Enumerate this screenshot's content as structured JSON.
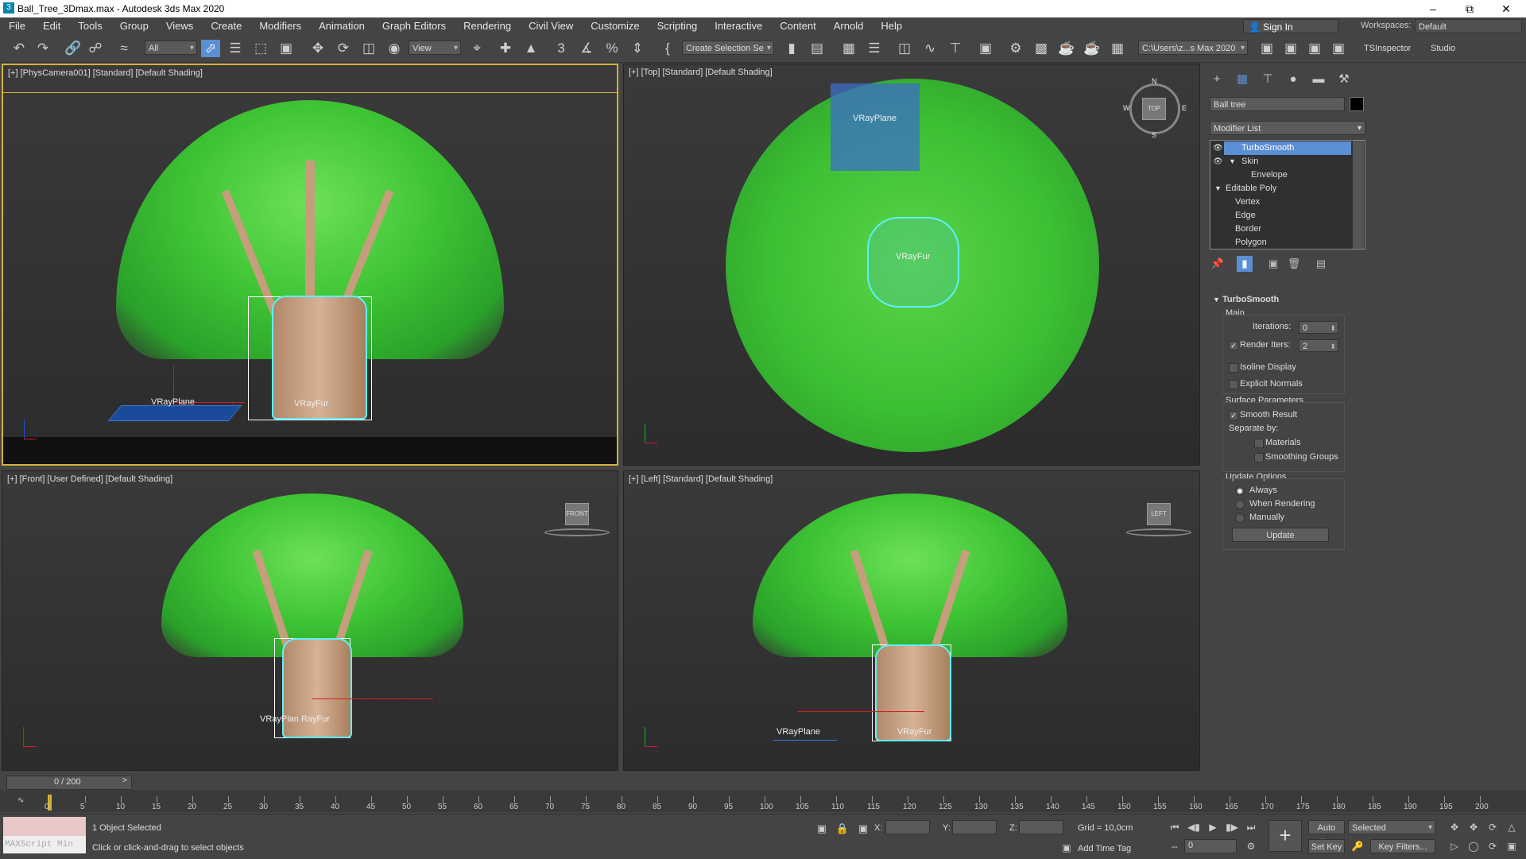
{
  "window": {
    "title": "Ball_Tree_3Dmax.max - Autodesk 3ds Max 2020",
    "app_icon": "3ds-max-icon"
  },
  "menu": {
    "items": [
      "File",
      "Edit",
      "Tools",
      "Group",
      "Views",
      "Create",
      "Modifiers",
      "Animation",
      "Graph Editors",
      "Rendering",
      "Civil View",
      "Customize",
      "Scripting",
      "Interactive",
      "Content",
      "Arnold",
      "Help"
    ],
    "sign_in": "Sign In",
    "workspaces_label": "Workspaces:",
    "workspaces_value": "Default"
  },
  "toolbar": {
    "selection_filter": "All",
    "reference_coord": "View",
    "named_selection": "Create Selection Se",
    "project_path": "C:\\Users\\z...s Max 2020",
    "tsinspector": "TSInspector",
    "studio": "Studio"
  },
  "viewports": {
    "camera": {
      "label": "[+] [PhysCamera001] [Standard] [Default Shading]",
      "objects": {
        "plane": "VRayPlane",
        "fur": "VRayFur"
      }
    },
    "top": {
      "label": "[+] [Top] [Standard] [Default Shading]",
      "objects": {
        "plane": "VRayPlane",
        "fur": "VRayFur"
      },
      "compass": {
        "n": "N",
        "s": "S",
        "w": "W",
        "e": "E",
        "cube": "TOP"
      }
    },
    "front": {
      "label": "[+] [Front] [User Defined] [Default Shading]",
      "objects": {
        "combined": "VRayPlan RayFur"
      },
      "cube": "FRONT"
    },
    "left": {
      "label": "[+] [Left] [Standard] [Default Shading]",
      "objects": {
        "plane": "VRayPlane",
        "fur": "VRayFur"
      },
      "cube": "LEFT"
    }
  },
  "command_panel": {
    "object_name": "Ball tree",
    "object_color": "#000000",
    "modifier_list": "Modifier List",
    "stack": [
      {
        "label": "TurboSmooth",
        "selected": true
      },
      {
        "label": "Skin"
      },
      {
        "label": "Envelope"
      },
      {
        "label": "Editable Poly"
      },
      {
        "label": "Vertex"
      },
      {
        "label": "Edge"
      },
      {
        "label": "Border"
      },
      {
        "label": "Polygon"
      }
    ],
    "turbosmooth": {
      "title": "TurboSmooth",
      "main": "Main",
      "iterations_label": "Iterations:",
      "iterations": "0",
      "render_iters_label": "Render Iters:",
      "render_iters": "2",
      "render_iters_checked": true,
      "isoline": "Isoline Display",
      "isoline_checked": false,
      "explicit_normals": "Explicit Normals",
      "explicit_normals_checked": false,
      "surface_params": "Surface Parameters",
      "smooth_result": "Smooth Result",
      "smooth_result_checked": true,
      "separate_by": "Separate by:",
      "materials": "Materials",
      "materials_checked": false,
      "smoothing_groups": "Smoothing Groups",
      "smoothing_groups_checked": false,
      "update_options": "Update Options",
      "always": "Always",
      "when_rendering": "When Rendering",
      "manually": "Manually",
      "update_mode": "Always",
      "update_button": "Update"
    }
  },
  "timeline": {
    "frame_display": "0 / 200",
    "ticks": [
      "0",
      "5",
      "10",
      "15",
      "20",
      "25",
      "30",
      "35",
      "40",
      "45",
      "50",
      "55",
      "60",
      "65",
      "70",
      "75",
      "80",
      "85",
      "90",
      "95",
      "100",
      "105",
      "110",
      "115",
      "120",
      "125",
      "130",
      "135",
      "140",
      "145",
      "150",
      "155",
      "160",
      "165",
      "170",
      "175",
      "180",
      "185",
      "190",
      "195",
      "200"
    ]
  },
  "status": {
    "maxscript_placeholder": "MAXScript Min",
    "selected_text": "1 Object Selected",
    "prompt": "Click or click-and-drag to select objects",
    "x_label": "X:",
    "y_label": "Y:",
    "z_label": "Z:",
    "grid": "Grid = 10,0cm",
    "add_time_tag": "Add Time Tag",
    "auto_key": "Auto Key",
    "set_key": "Set Key",
    "key_mode": "Selected",
    "key_filters": "Key Filters...",
    "current_frame": "0"
  }
}
